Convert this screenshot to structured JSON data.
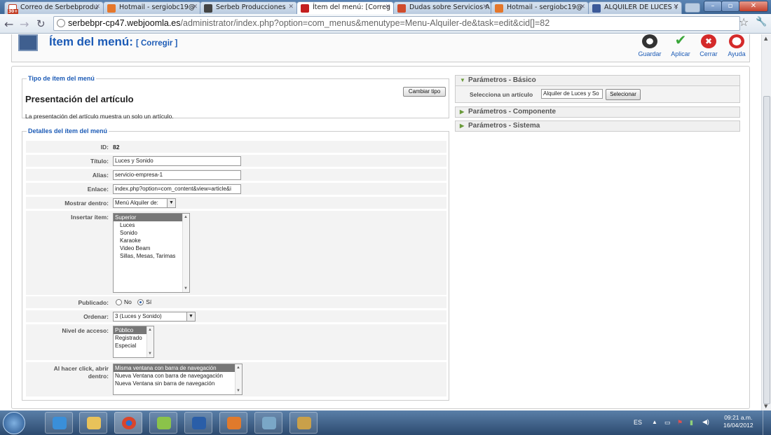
{
  "browser": {
    "tabs": [
      {
        "title": "Correo de Serbebprodu",
        "fav_color": "#c23b22"
      },
      {
        "title": "Hotmail - sergiobc19@",
        "fav_color": "#e5772b"
      },
      {
        "title": "Serbeb Producciones",
        "fav_color": "#444444"
      },
      {
        "title": "Ítem del menú: [Correg",
        "fav_color": "#c41f1f"
      },
      {
        "title": "Dudas sobre Servicios A",
        "fav_color": "#d04c2c"
      },
      {
        "title": "Hotmail - sergiobc19@",
        "fav_color": "#e5772b"
      },
      {
        "title": "ALQUILER DE LUCES Y",
        "fav_color": "#3b5998"
      }
    ],
    "mail_badge": "30+",
    "url_host": "serbebpr-cp47.webjoomla.es",
    "url_path": "/administrator/index.php?option=com_menus&menutype=Menu-Alquiler-de&task=edit&cid[]=82"
  },
  "header": {
    "title": "Ítem del menú:",
    "subtitle": "[ Corregir ]",
    "buttons": [
      {
        "label": "Guardar",
        "icon": "save-icon",
        "color": "#333333"
      },
      {
        "label": "Aplicar",
        "icon": "check-icon",
        "color": "#3aa63a"
      },
      {
        "label": "Cerrar",
        "icon": "close-icon",
        "color": "#d42a2a"
      },
      {
        "label": "Ayuda",
        "icon": "help-icon",
        "color": "#d42a2a"
      }
    ]
  },
  "type_section": {
    "legend": "Tipo de ítem del menú",
    "title": "Presentación del artículo",
    "description": "La presentación del artículo muestra un solo un artículo.",
    "change_button": "Cambiar tipo"
  },
  "details": {
    "legend": "Detalles del ítem del menú",
    "id_label": "ID:",
    "id_value": "82",
    "title_label": "Título:",
    "title_value": "Luces y Sonido",
    "alias_label": "Alias:",
    "alias_value": "servicio-empresa-1",
    "link_label": "Enlace:",
    "link_value": "index.php?option=com_content&view=article&i",
    "menu_label": "Mostrar dentro:",
    "menu_value": "Menú Alquiler de:",
    "parent_label": "Insertar ítem:",
    "parent_options": [
      "Superior",
      "Luces",
      "Sonido",
      "Karaoke",
      "Video Beam",
      "Sillas, Mesas, Tarimas"
    ],
    "published_label": "Publicado:",
    "published_no": "No",
    "published_yes": "Sí",
    "order_label": "Ordenar:",
    "order_value": "3 (Luces y Sonido)",
    "access_label": "Nivel de acceso:",
    "access_options": [
      "Público",
      "Registrado",
      "Especial"
    ],
    "open_label_1": "Al hacer click, abrir",
    "open_label_2": "dentro:",
    "open_options": [
      "Misma ventana con barra de navegación",
      "Nueva Ventana con barra de navegagación",
      "Nueva Ventana sin barra de navegación"
    ]
  },
  "params": {
    "basic": "Parámetros - Básico",
    "article_label": "Selecciona un artículo",
    "article_value": "Alquiler de Luces y So",
    "select_button": "Selecionar",
    "component": "Parámetros - Componente",
    "system": "Parámetros - Sistema"
  },
  "taskbar": {
    "lang": "ES",
    "time": "09:21 a.m.",
    "date": "16/04/2012",
    "apps": [
      {
        "icon": "ie-icon",
        "color": "#3a8fd9"
      },
      {
        "icon": "explorer-icon",
        "color": "#e8c25a"
      },
      {
        "icon": "chrome-icon",
        "color": "#d9452c"
      },
      {
        "icon": "notes-icon",
        "color": "#8bc34a"
      },
      {
        "icon": "word-icon",
        "color": "#2a5ea8"
      },
      {
        "icon": "media-icon",
        "color": "#e07a2c"
      },
      {
        "icon": "window-icon",
        "color": "#7aa7c7"
      },
      {
        "icon": "paint-icon",
        "color": "#c9a04a"
      }
    ]
  }
}
